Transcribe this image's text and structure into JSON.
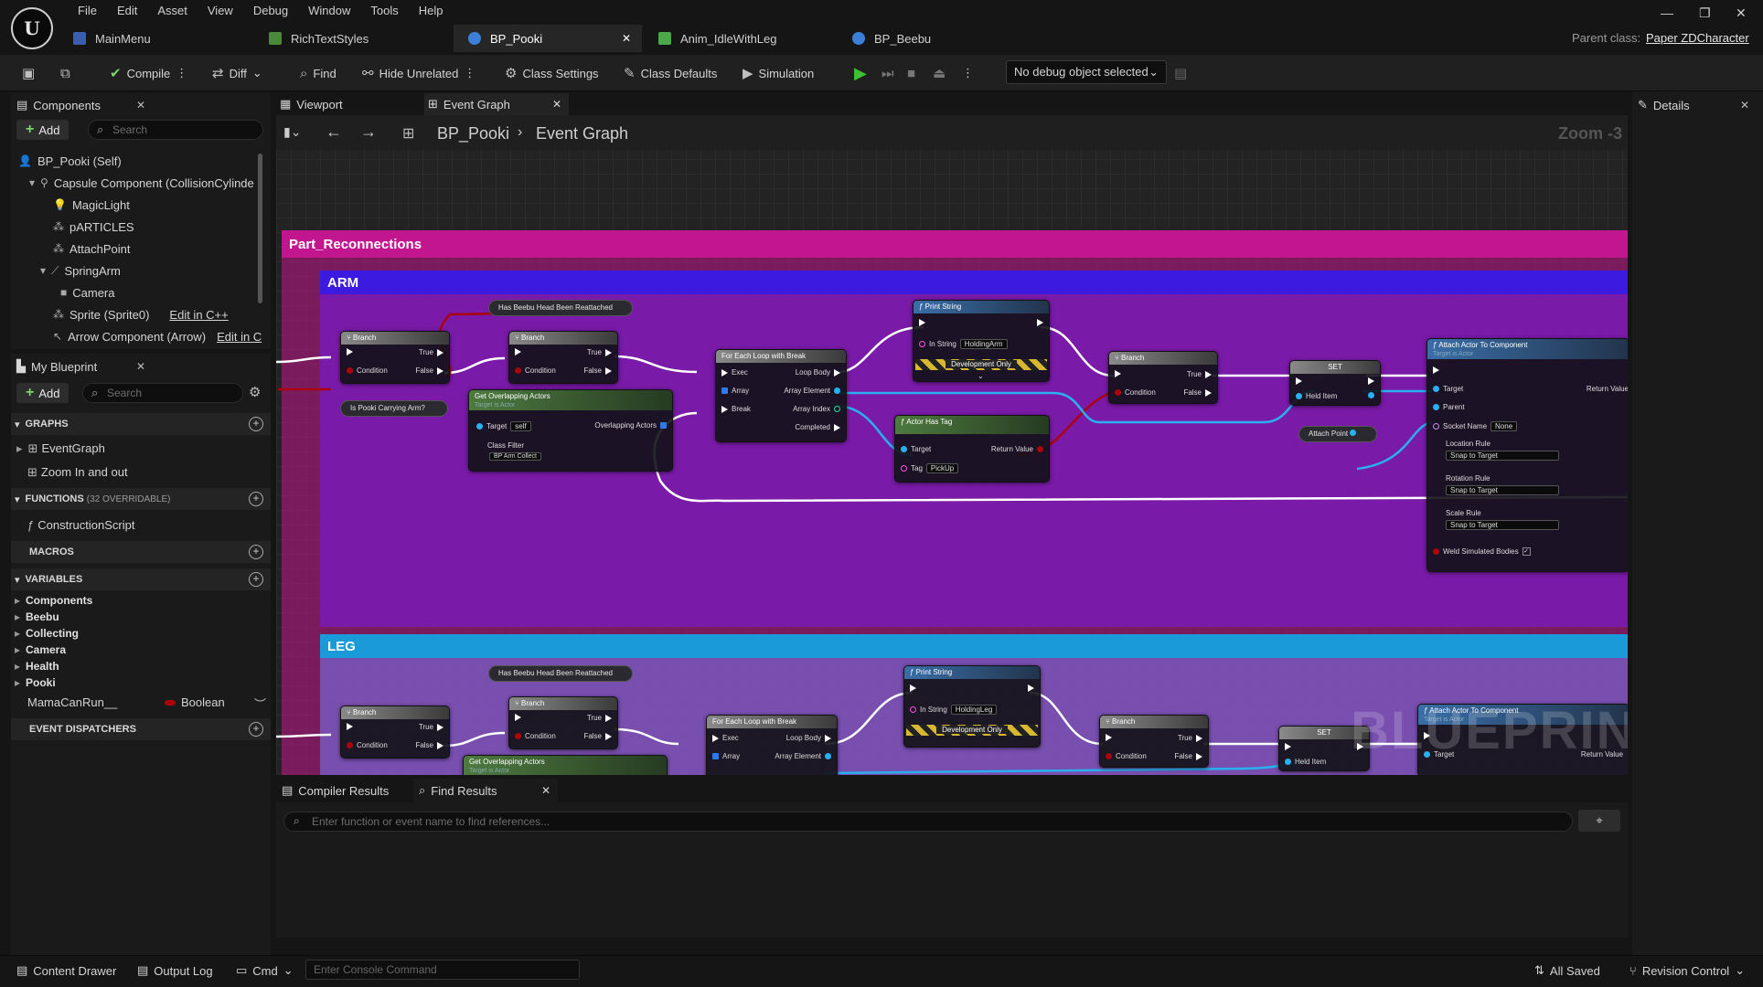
{
  "menu": [
    "File",
    "Edit",
    "Asset",
    "View",
    "Debug",
    "Window",
    "Tools",
    "Help"
  ],
  "tabs": [
    {
      "label": "MainMenu"
    },
    {
      "label": "RichTextStyles"
    },
    {
      "label": "BP_Pooki"
    },
    {
      "label": "Anim_IdleWithLeg"
    },
    {
      "label": "BP_Beebu"
    }
  ],
  "parent_class": {
    "label": "Parent class:",
    "value": "Paper ZDCharacter"
  },
  "toolbar": {
    "compile": "Compile",
    "diff": "Diff",
    "find": "Find",
    "hide_unrelated": "Hide Unrelated",
    "class_settings": "Class Settings",
    "class_defaults": "Class Defaults",
    "simulation": "Simulation",
    "debug_object": "No debug object selected"
  },
  "components_panel": {
    "title": "Components",
    "add": "Add",
    "search_placeholder": "Search",
    "tree": [
      {
        "label": "BP_Pooki (Self)"
      },
      {
        "label": "Capsule Component (CollisionCylinde"
      },
      {
        "label": "MagicLight"
      },
      {
        "label": "pARTICLES"
      },
      {
        "label": "AttachPoint"
      },
      {
        "label": "SpringArm"
      },
      {
        "label": "Camera"
      },
      {
        "label": "Sprite (Sprite0)",
        "link": "Edit in C++"
      },
      {
        "label": "Arrow Component (Arrow)",
        "link": "Edit in C"
      }
    ]
  },
  "my_blueprint": {
    "title": "My Blueprint",
    "add": "Add",
    "search_placeholder": "Search",
    "graphs_header": "GRAPHS",
    "graphs": [
      "EventGraph",
      "Zoom In and out"
    ],
    "functions_header": "FUNCTIONS",
    "functions_note": "(32 OVERRIDABLE)",
    "functions": [
      "ConstructionScript"
    ],
    "macros_header": "MACROS",
    "variables_header": "VARIABLES",
    "variable_categories": [
      "Components",
      "Beebu",
      "Collecting",
      "Camera",
      "Health",
      "Pooki"
    ],
    "variable": {
      "name": "MamaCanRun__",
      "type": "Boolean"
    },
    "dispatchers_header": "EVENT DISPATCHERS"
  },
  "graph_tabs": {
    "viewport": "Viewport",
    "event_graph": "Event Graph"
  },
  "breadcrumb": {
    "root": "BP_Pooki",
    "current": "Event Graph",
    "zoom": "Zoom -3"
  },
  "graph": {
    "outer_comment": "Part_Reconnections",
    "arm_comment": "ARM",
    "leg_comment": "LEG",
    "watermark": "BLUEPRINT",
    "nodes": {
      "branch": "Branch",
      "true": "True",
      "false": "False",
      "condition": "Condition",
      "has_beebu_head": "Has Beebu Head Been Reattached",
      "is_pooki_carrying_arm": "Is Pooki Carrying Arm?",
      "get_overlapping": "Get Overlapping Actors",
      "target_is_actor": "Target is Actor",
      "target": "Target",
      "self": "self",
      "overlapping_actors": "Overlapping Actors",
      "class_filter": "Class Filter",
      "class_filter_value": "BP Arm Collect",
      "for_each": "For Each Loop with Break",
      "exec": "Exec",
      "loop_body": "Loop Body",
      "array": "Array",
      "array_element": "Array Element",
      "array_index": "Array Index",
      "break": "Break",
      "completed": "Completed",
      "print_string": "Print String",
      "in_string": "In String",
      "holding_arm": "HoldingArm",
      "holding_leg": "HoldingLeg",
      "development_only": "Development Only",
      "actor_has_tag": "Actor Has Tag",
      "return_value": "Return Value",
      "tag": "Tag",
      "pickup": "PickUp",
      "set": "SET",
      "held_item": "Held Item",
      "attach_point": "Attach Point",
      "attach_actor": "Attach Actor To Component",
      "parent": "Parent",
      "socket_name": "Socket Name",
      "none": "None",
      "location_rule": "Location Rule",
      "rotation_rule": "Rotation Rule",
      "scale_rule": "Scale Rule",
      "snap_to_target": "Snap to Target",
      "weld_simulated": "Weld Simulated Bodies"
    }
  },
  "bottom_panel": {
    "compiler_results": "Compiler Results",
    "find_results": "Find Results",
    "find_placeholder": "Enter function or event name to find references..."
  },
  "details": {
    "title": "Details"
  },
  "status_bar": {
    "content_drawer": "Content Drawer",
    "output_log": "Output Log",
    "cmd": "Cmd",
    "console_placeholder": "Enter Console Command",
    "all_saved": "All Saved",
    "revision_control": "Revision Control"
  },
  "colors": {
    "outer_comment": "#c2168f",
    "arm_comment": "#7a1ad0",
    "leg_comment": "#1a9ad8",
    "exec_wire": "#ffffff",
    "bool_wire": "#a9050a",
    "object_wire": "#2ab0ef"
  }
}
